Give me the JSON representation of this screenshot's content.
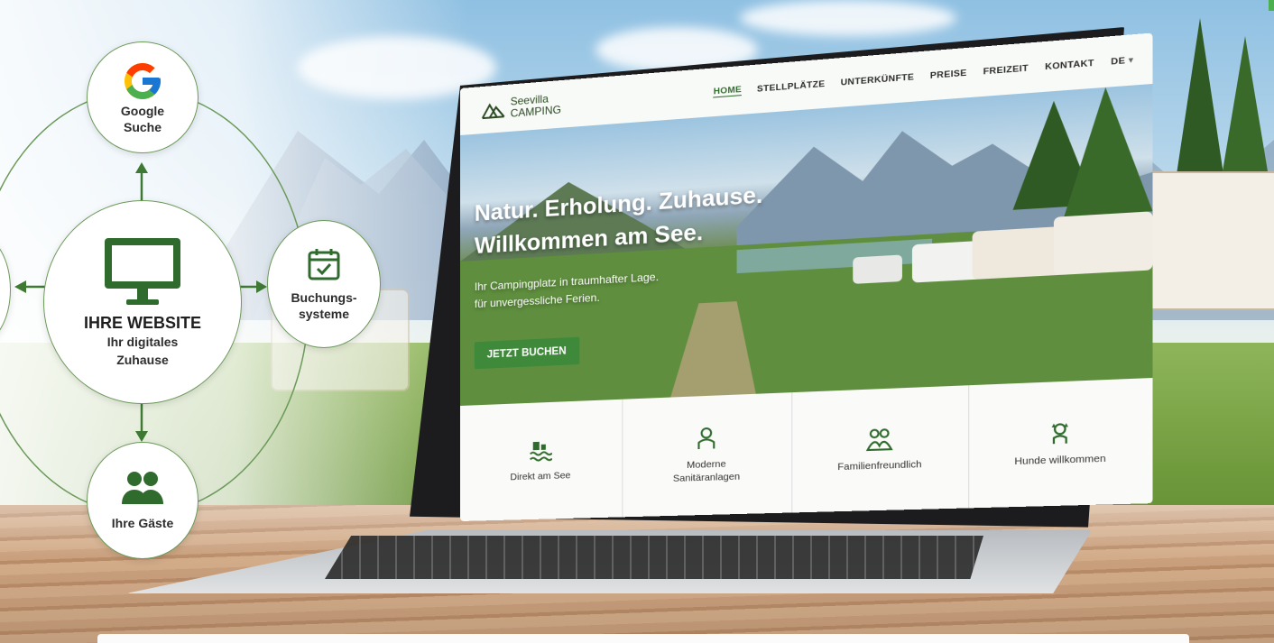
{
  "diagram": {
    "center": {
      "title": "IHRE WEBSITE",
      "subtitle_line1": "Ihr digitales",
      "subtitle_line2": "Zuhause",
      "icon": "monitor-icon"
    },
    "nodes": [
      {
        "key": "google",
        "line1": "Google",
        "line2": "Suche",
        "icon": "google-g-icon"
      },
      {
        "key": "booking",
        "line1": "Buchungs-",
        "line2": "systeme",
        "icon": "calendar-check-icon"
      },
      {
        "key": "guests",
        "line1": "Ihre Gäste",
        "line2": "",
        "icon": "people-icon"
      }
    ],
    "accent": "#2f6b2c"
  },
  "website": {
    "logo": {
      "line1": "Seevilla",
      "line2": "CAMPING"
    },
    "nav": [
      "HOME",
      "STELLPLÄTZE",
      "UNTERKÜNFTE",
      "PREISE",
      "FREIZEIT",
      "KONTAKT"
    ],
    "lang": "DE",
    "hero": {
      "title_line1": "Natur. Erholung. Zuhause.",
      "title_line2": "Willkommen am See.",
      "sub_line1": "Ihr Campingplatz in traumhafter Lage.",
      "sub_line2": "für unvergessliche Ferien.",
      "cta": "JETZT BUCHEN"
    },
    "features": [
      {
        "label_line1": "Direkt am See",
        "label_line2": "",
        "icon": "lake-icon"
      },
      {
        "label_line1": "Moderne",
        "label_line2": "Sanitäranlagen",
        "icon": "sanitary-icon"
      },
      {
        "label_line1": "Familienfreundlich",
        "label_line2": "",
        "icon": "family-icon"
      },
      {
        "label_line1": "Hunde willkommen",
        "label_line2": "",
        "icon": "dog-icon"
      }
    ],
    "colors": {
      "primary": "#3f8a3a",
      "nav_text": "#2b2b2b"
    }
  }
}
